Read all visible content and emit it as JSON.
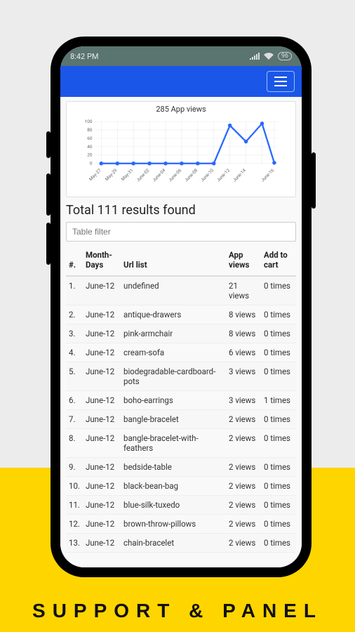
{
  "status_bar": {
    "time": "8:42 PM",
    "battery": "96"
  },
  "chart_title": "285 App views",
  "chart_data": {
    "type": "line",
    "categories": [
      "May-27",
      "May-29",
      "May-31",
      "June-02",
      "June-04",
      "June-06",
      "June-08",
      "June-10",
      "June-12",
      "June-14",
      "June-16"
    ],
    "values": [
      0,
      0,
      0,
      0,
      0,
      0,
      0,
      0,
      90,
      52,
      95,
      2
    ],
    "note_extra_point_between_14_16": 95,
    "series": [
      {
        "name": "App views",
        "values": [
          0,
          0,
          0,
          0,
          0,
          0,
          0,
          0,
          90,
          52,
          95,
          2
        ]
      }
    ],
    "ylabel": "",
    "xlabel": "",
    "ylim": [
      0,
      100
    ],
    "yticks": [
      0,
      20,
      40,
      60,
      80,
      100
    ],
    "title": "285 App views"
  },
  "results_title": "Total 111 results found",
  "filter_placeholder": "Table filter",
  "table": {
    "headers": {
      "num": "#.",
      "month": "Month-Days",
      "url": "Url list",
      "views": "App views",
      "cart": "Add to cart"
    },
    "rows": [
      {
        "n": "1.",
        "month": "June-12",
        "url": "undefined",
        "views": "21 views",
        "cart": "0 times"
      },
      {
        "n": "2.",
        "month": "June-12",
        "url": "antique-drawers",
        "views": "8 views",
        "cart": "0 times"
      },
      {
        "n": "3.",
        "month": "June-12",
        "url": "pink-armchair",
        "views": "8 views",
        "cart": "0 times"
      },
      {
        "n": "4.",
        "month": "June-12",
        "url": "cream-sofa",
        "views": "6 views",
        "cart": "0 times"
      },
      {
        "n": "5.",
        "month": "June-12",
        "url": "biodegradable-cardboard-pots",
        "views": "3 views",
        "cart": "0 times"
      },
      {
        "n": "6.",
        "month": "June-12",
        "url": "boho-earrings",
        "views": "3 views",
        "cart": "1 times"
      },
      {
        "n": "7.",
        "month": "June-12",
        "url": "bangle-bracelet",
        "views": "2 views",
        "cart": "0 times"
      },
      {
        "n": "8.",
        "month": "June-12",
        "url": "bangle-bracelet-with-feathers",
        "views": "2 views",
        "cart": "0 times"
      },
      {
        "n": "9.",
        "month": "June-12",
        "url": "bedside-table",
        "views": "2 views",
        "cart": "0 times"
      },
      {
        "n": "10.",
        "month": "June-12",
        "url": "black-bean-bag",
        "views": "2 views",
        "cart": "0 times"
      },
      {
        "n": "11.",
        "month": "June-12",
        "url": "blue-silk-tuxedo",
        "views": "2 views",
        "cart": "0 times"
      },
      {
        "n": "12.",
        "month": "June-12",
        "url": "brown-throw-pillows",
        "views": "2 views",
        "cart": "0 times"
      },
      {
        "n": "13.",
        "month": "June-12",
        "url": "chain-bracelet",
        "views": "2 views",
        "cart": "0 times"
      }
    ]
  },
  "footer_text": "SUPPORT & PANEL",
  "colors": {
    "accent": "#1a56e8",
    "chart_line": "#2968ff",
    "yellow": "#ffd500"
  }
}
